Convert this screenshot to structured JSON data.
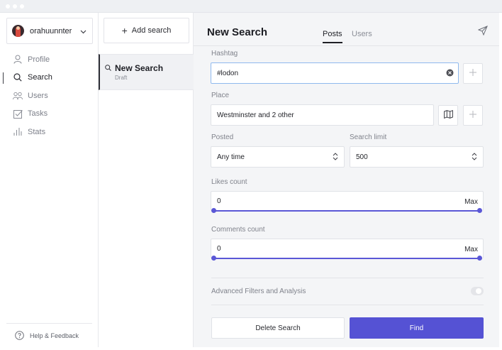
{
  "window": {
    "traffic_lights": [
      "close",
      "minimize",
      "zoom"
    ]
  },
  "account": {
    "username": "orahuunnter",
    "avatar_icon": "avatar-image",
    "chevron_icon": "chevron-down-icon"
  },
  "sidebar": {
    "items": [
      {
        "label": "Profile",
        "icon": "user-icon",
        "active": false
      },
      {
        "label": "Search",
        "icon": "search-icon",
        "active": true
      },
      {
        "label": "Users",
        "icon": "users-icon",
        "active": false
      },
      {
        "label": "Tasks",
        "icon": "checkbox-icon",
        "active": false
      },
      {
        "label": "Stats",
        "icon": "bar-chart-icon",
        "active": false
      }
    ],
    "help_label": "Help & Feedback"
  },
  "searches": {
    "add_label": "Add search",
    "items": [
      {
        "title": "New Search",
        "subtitle": "Draft"
      }
    ]
  },
  "main": {
    "title": "New Search",
    "tabs": [
      {
        "label": "Posts",
        "active": true
      },
      {
        "label": "Users",
        "active": false
      }
    ],
    "hashtag": {
      "label": "Hashtag",
      "value": "#lodon"
    },
    "place": {
      "label": "Place",
      "value": "Westminster and 2 other"
    },
    "posted": {
      "label": "Posted",
      "value": "Any time"
    },
    "search_limit": {
      "label": "Search limit",
      "value": "500"
    },
    "likes": {
      "label": "Likes count",
      "min": "0",
      "max": "Max",
      "range_fraction": [
        0,
        1
      ]
    },
    "comments": {
      "label": "Comments count",
      "min": "0",
      "max": "Max",
      "range_fraction": [
        0,
        1
      ]
    },
    "advanced": {
      "label": "Advanced Filters and Analysis",
      "enabled": false
    },
    "delete_label": "Delete Search",
    "find_label": "Find"
  },
  "colors": {
    "accent": "#5552d4",
    "focus_border": "#8fb9ee",
    "panel_bg": "#f4f5f7"
  }
}
